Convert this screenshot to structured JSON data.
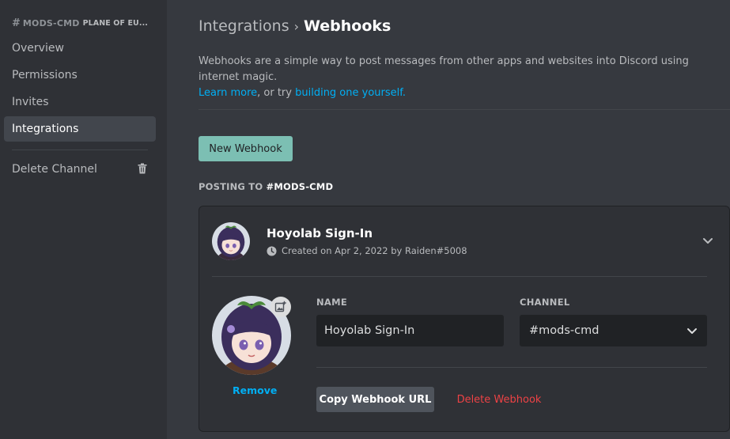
{
  "sidebar": {
    "header_hash": "#",
    "header_channel": "MODS-CMD",
    "header_category": "PLANE OF EU...",
    "items": [
      {
        "label": "Overview"
      },
      {
        "label": "Permissions"
      },
      {
        "label": "Invites"
      },
      {
        "label": "Integrations"
      }
    ],
    "delete_channel": "Delete Channel"
  },
  "main": {
    "breadcrumb_parent": "Integrations",
    "breadcrumb_separator": "›",
    "breadcrumb_current": "Webhooks",
    "description_text": "Webhooks are a simple way to post messages from other apps and websites into Discord using internet magic.",
    "learn_more": "Learn more",
    "or_try": ", or try ",
    "building_link": "building one yourself.",
    "new_webhook_button": "New Webhook",
    "posting_to_label": "POSTING TO ",
    "posting_to_channel": "#MODS-CMD"
  },
  "webhook": {
    "name": "Hoyolab Sign-In",
    "created_text": "Created on Apr 2, 2022 by Raiden#5008",
    "remove_label": "Remove",
    "name_label": "NAME",
    "name_value": "Hoyolab Sign-In",
    "channel_label": "CHANNEL",
    "channel_value": "#mods-cmd",
    "copy_url_button": "Copy Webhook URL",
    "delete_button": "Delete Webhook"
  },
  "colors": {
    "accent_link": "#00aff4",
    "new_webhook_bg": "#7cbfb3",
    "danger": "#ed4245",
    "sidebar_bg": "#2f3136",
    "main_bg": "#36393f"
  }
}
